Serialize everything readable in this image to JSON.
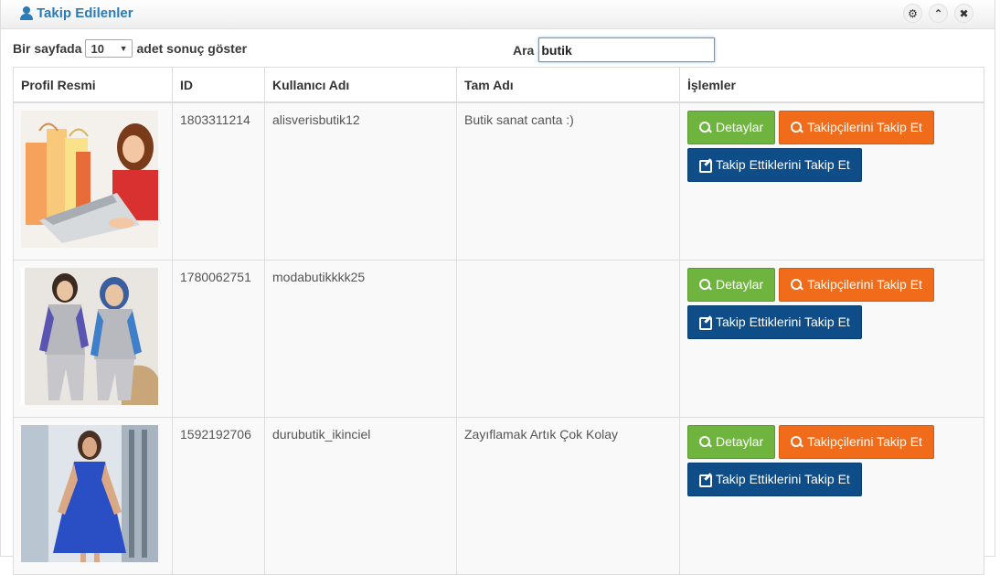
{
  "widget": {
    "title": "Takip Edilenler",
    "tools": {
      "settings": "⚙",
      "collapse": "⌃",
      "close": "✖"
    }
  },
  "length_control": {
    "prefix": "Bir sayfada",
    "value": "10",
    "suffix": "adet sonuç göster"
  },
  "search": {
    "label": "Ara",
    "value": "butik"
  },
  "table": {
    "columns": [
      "Profil Resmi",
      "ID",
      "Kullanıcı Adı",
      "Tam Adı",
      "İşlemler"
    ],
    "buttons": {
      "details": "Detaylar",
      "follow_followers": "Takipçilerini Takip Et",
      "follow_following": "Takip Ettiklerini Takip Et"
    },
    "rows": [
      {
        "id": "1803311214",
        "username": "alisverisbutik12",
        "fullname": "Butik sanat canta :)"
      },
      {
        "id": "1780062751",
        "username": "modabutikkkk25",
        "fullname": ""
      },
      {
        "id": "1592192706",
        "username": "durubutik_ikinciel",
        "fullname": "Zayıflamak Artık Çok Kolay"
      }
    ]
  }
}
